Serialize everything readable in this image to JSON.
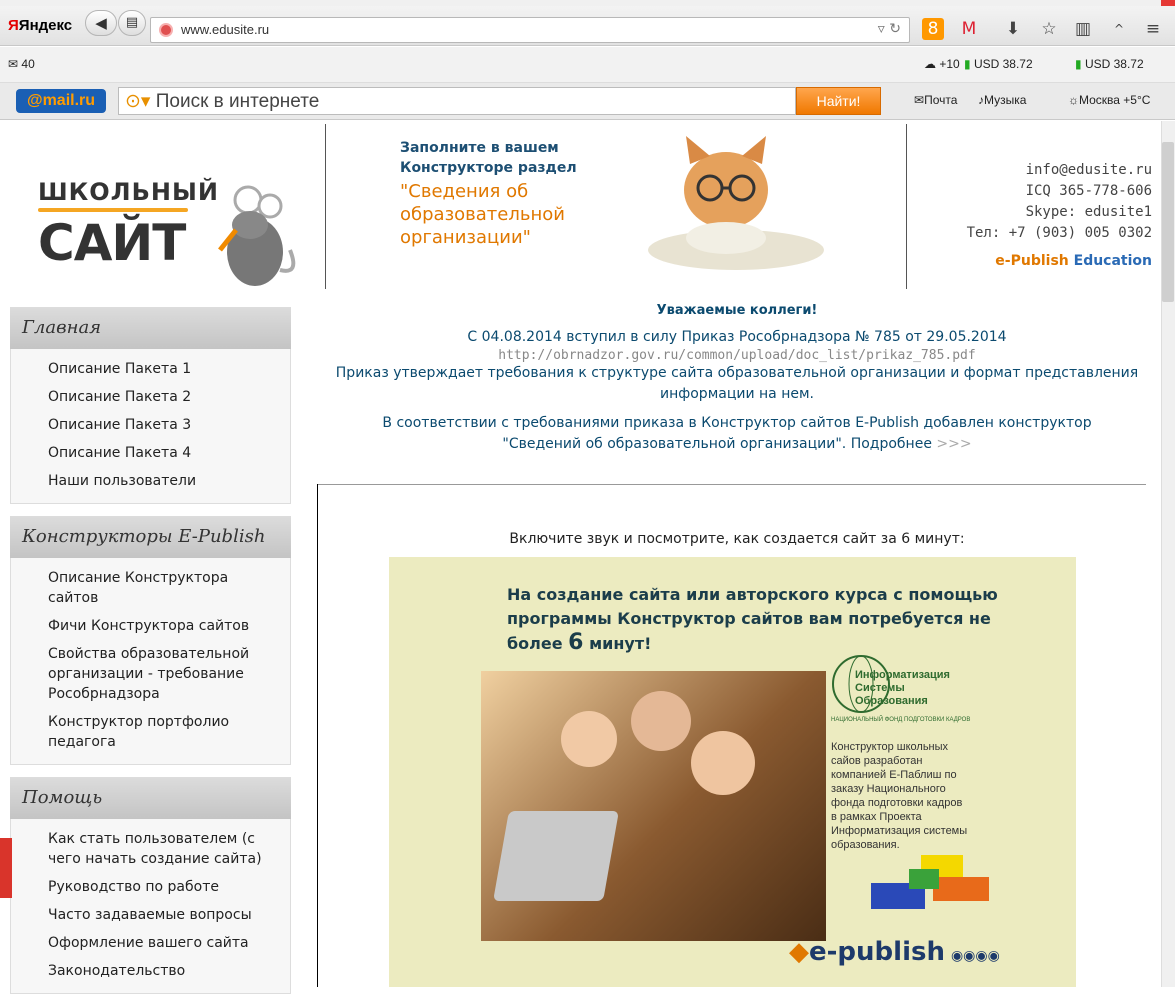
{
  "browser": {
    "brand": "Яндекс",
    "url": "www.edusite.ru",
    "mail_count": "40",
    "weather": "+10",
    "usd1": "USD 38.72",
    "usd2": "USD 38.72"
  },
  "mailbar": {
    "logo": "@mail.ru",
    "search_placeholder": "Поиск в интернете",
    "find_label": "Найти!",
    "mail_label": "Почта",
    "music_label": "Музыка",
    "weather_label": "Москва +5°C"
  },
  "header": {
    "banner": {
      "l1": "Заполните в вашем",
      "l2": "Конструкторе раздел",
      "l3": "\"Сведения об",
      "l4": "образовательной",
      "l5": "организации\""
    },
    "contacts": {
      "email": "info@edusite.ru",
      "icq": "ICQ 365-778-606",
      "skype": "Skype: edusite1",
      "phone": "Тел: +7 (903) 005 0302",
      "brand1": "e-Publish",
      "brand2": "Education"
    }
  },
  "sidebar": [
    {
      "title": "Главная",
      "items": [
        "Описание Пакета 1",
        "Описание Пакета 2",
        "Описание Пакета 3",
        "Описание Пакета 4",
        "Наши пользователи"
      ]
    },
    {
      "title": "Конструкторы E-Publish",
      "items": [
        "Описание Конструктора сайтов",
        "Фичи Конструктора сайтов",
        "Свойства образовательной организации - требование Рособрнадзора",
        "Конструктор портфолио педагога"
      ]
    },
    {
      "title": "Помощь",
      "items": [
        "Как стать пользователем (с чего начать создание сайта)",
        "Руководство по работе",
        "Часто задаваемые вопросы",
        "Оформление вашего сайта",
        "Законодательство"
      ]
    }
  ],
  "announcement": {
    "title": "Уважаемые коллеги!",
    "p1": "С 04.08.2014 вступил в силу Приказ Рособрнадзора № 785 от 29.05.2014",
    "link": "http://obrnadzor.gov.ru/common/upload/doc_list/prikaz_785.pdf",
    "p2": "Приказ утверждает требования к структуре сайта образовательной организации и формат представления информации на нем.",
    "p3a": "В соответствии с требованиями приказа в Конструктор сайтов E-Publish добавлен конструктор",
    "p3b": "\"Сведений об образовательной организации\". Подробнее",
    "more": ">>>"
  },
  "promo": {
    "caption": "Включите звук и посмотрите, как создается сайт за 6 минут:",
    "text_a": "На создание сайта или авторского курса с помощью программы Конструктор сайтов вам потребуется не",
    "text_b": "более",
    "six": "6",
    "text_c": "минут!",
    "ifo_1": "Информатизация",
    "ifo_2": "Системы",
    "ifo_3": "Образования",
    "ifo_sub": "НАЦИОНАЛЬНЫЙ ФОНД ПОДГОТОВКИ КАДРОВ",
    "ifo_text": "Конструктор школьных сайов разработан компанией Е-Паблиш по заказу Национального фонда подготовки кадров в рамках Проекта Информатизация системы образования.",
    "brand": "e-publish"
  },
  "logo": {
    "line1": "ШКОЛЬНЫЙ",
    "line2": "САЙТ"
  },
  "colors": {
    "accent": "#f07800",
    "brand_red": "#e30000",
    "link_blue": "#0b4a6f",
    "promo_bg": "#ecebc0"
  }
}
